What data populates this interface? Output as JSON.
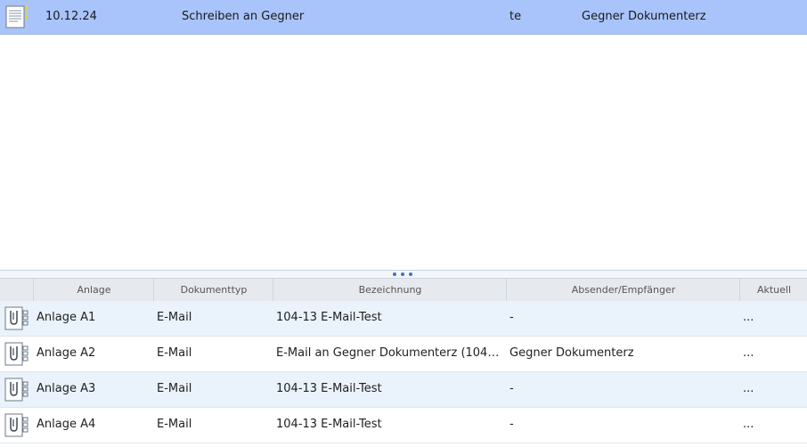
{
  "top_row": {
    "date": "10.12.24",
    "title": "Schreiben an Gegner",
    "initials": "te",
    "party": "Gegner Dokumenterz",
    "icon": "document-icon"
  },
  "columns": {
    "c0": "",
    "c1": "Anlage",
    "c2": "Dokumenttyp",
    "c3": "Bezeichnung",
    "c4": "Absender/Empfänger",
    "c5": "Aktuell"
  },
  "rows": [
    {
      "anlage": "Anlage A1",
      "typ": "E-Mail",
      "bezeichnung": "104-13 E-Mail-Test",
      "absender": "-",
      "aktuell": "...",
      "icon": "paperclip-attachment-icon"
    },
    {
      "anlage": "Anlage A2",
      "typ": "E-Mail",
      "bezeichnung": "E-Mail an Gegner Dokumenterz (104-13 ...",
      "absender": "Gegner Dokumenterz",
      "aktuell": "...",
      "icon": "paperclip-attachment-icon"
    },
    {
      "anlage": "Anlage A3",
      "typ": "E-Mail",
      "bezeichnung": "104-13 E-Mail-Test",
      "absender": "-",
      "aktuell": "...",
      "icon": "paperclip-attachment-icon"
    },
    {
      "anlage": "Anlage A4",
      "typ": "E-Mail",
      "bezeichnung": "104-13 E-Mail-Test",
      "absender": "-",
      "aktuell": "...",
      "icon": "paperclip-attachment-icon"
    }
  ],
  "colors": {
    "selected_row": "#a9c4fb",
    "alt_row": "#eaf3fb",
    "header_bg": "#e6e9ee",
    "splitter_dots": "#3b77c8"
  }
}
